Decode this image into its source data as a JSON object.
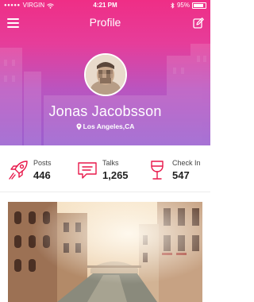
{
  "status_bar": {
    "carrier": "VIRGIN",
    "time": "4:21 PM",
    "battery": "95%"
  },
  "nav": {
    "title": "Profile"
  },
  "profile": {
    "name": "Jonas Jacobsson",
    "location": "Los Angeles,CA"
  },
  "stats": [
    {
      "label": "Posts",
      "value": "446",
      "icon": "rocket-icon"
    },
    {
      "label": "Talks",
      "value": "1,265",
      "icon": "chat-bubble-icon"
    },
    {
      "label": "Check In",
      "value": "547",
      "icon": "wine-glass-icon"
    }
  ],
  "colors": {
    "accent": "#e8194b",
    "gradient_top": "#ef2e86",
    "gradient_bottom": "#9a5fcf"
  }
}
